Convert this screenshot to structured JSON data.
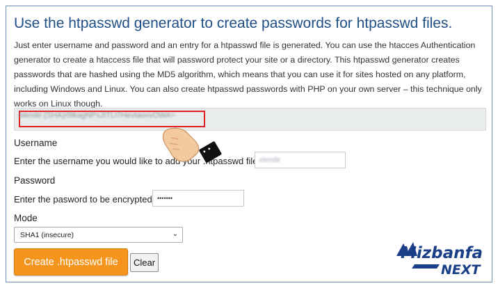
{
  "page": {
    "title": "Use the htpasswd generator to create passwords for htpasswd files.",
    "description": "Just enter username and password and an entry for a htpasswd file is generated. You can use the htacces Authentication generator to create a htaccess file that will password protect your site or a directory. This htpasswd generator creates passwords that are hashed using the MD5 algorithm, which means that you can use it for sites hosted on any platform, including Windows and Linux. You can also create htpasswd passwords with PHP on your own server – this technique only works on Linux though."
  },
  "result": {
    "output": "elendir:{SHA}rl9kagNPxJITLl7HevtaovvOWA=",
    "highlight_color": "#e02020"
  },
  "form": {
    "username_heading": "Username",
    "username_prompt": "Enter the username you would like to add your .htpasswd file.",
    "username_value": "elendir",
    "password_heading": "Password",
    "password_prompt": "Enter the pasword to be encrypted.",
    "password_value": "•••••••",
    "mode_heading": "Mode",
    "mode_selected": "SHA1 (insecure)",
    "create_label": "Create .htpasswd file",
    "clear_label": "Clear"
  },
  "logo": {
    "line1": "Mizbanfa",
    "line2": "NEXT"
  },
  "colors": {
    "title": "#1f4f86",
    "button": "#f6951e",
    "logo_blue": "#1b3f87"
  },
  "icons": {
    "pointer": "pointing-hand-icon",
    "select_chevron": "chevron-down-icon"
  }
}
